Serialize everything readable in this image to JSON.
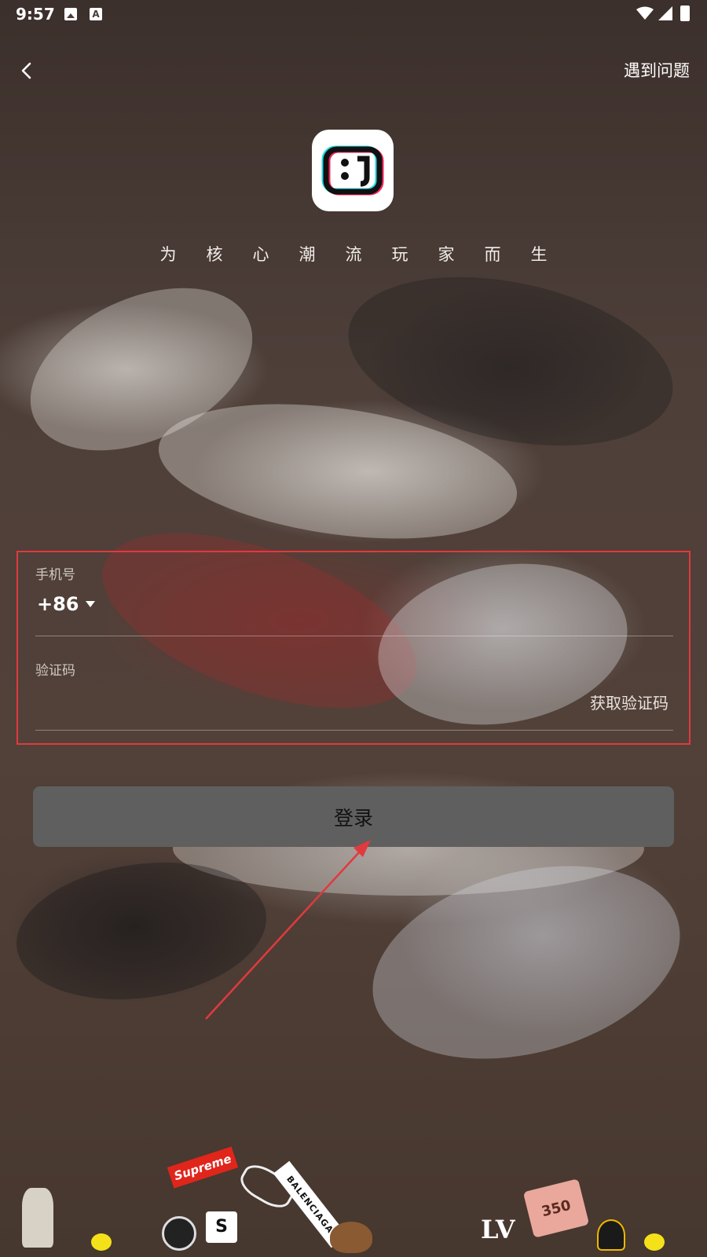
{
  "status_bar": {
    "time": "9:57",
    "a_badge": "A"
  },
  "nav": {
    "help_label": "遇到问题"
  },
  "brand": {
    "slogan": "为核心潮流玩家而生",
    "logo_text": "8J"
  },
  "form": {
    "phone_label": "手机号",
    "country_code": "+86",
    "phone_value": "",
    "code_label": "验证码",
    "code_value": "",
    "get_code_label": "获取验证码"
  },
  "login_button": {
    "label": "登录"
  },
  "stickers": {
    "supreme": "Supreme",
    "balenciaga": "BALENCIAGA",
    "salomon": "S",
    "boost": "350",
    "lv": "LV"
  },
  "colors": {
    "annotation_red": "#e03a3e",
    "button_bg": "#5f5f5f",
    "background": "#4a3c36"
  },
  "icons": {
    "back": "chevron-left-icon",
    "dropdown": "caret-down-icon",
    "wifi": "wifi-icon",
    "signal": "signal-icon",
    "battery": "battery-icon"
  }
}
